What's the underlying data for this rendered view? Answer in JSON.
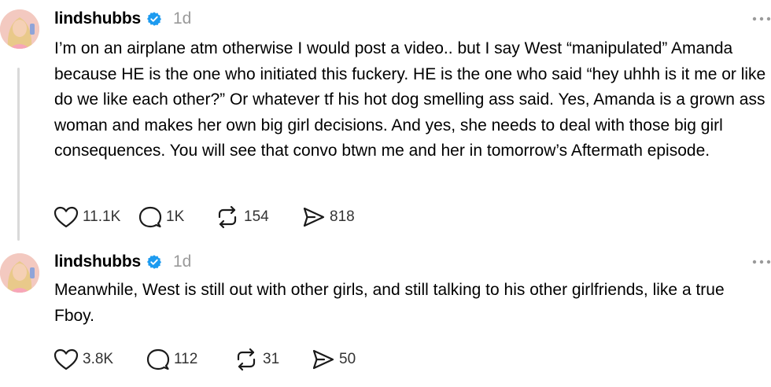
{
  "posts": [
    {
      "username": "lindshubbs",
      "time": "1d",
      "text": "I’m on an airplane atm otherwise I would post a video.. but I say West “manipulated” Amanda because HE is the one who initiated this fuckery. HE is the one who said “hey uhhh is it me or like do we like each other?” Or whatever tf his hot dog smelling ass said. Yes, Amanda is a grown ass woman and makes her own big girl decisions. And yes, she needs to deal with those big girl consequences. You will see that convo btwn me and her in tomorrow’s Aftermath episode.",
      "likes": "11.1K",
      "replies": "1K",
      "reposts": "154",
      "shares": "818"
    },
    {
      "username": "lindshubbs",
      "time": "1d",
      "text": "Meanwhile, West is still out with other girls, and still talking to his other girlfriends, like a true Fboy.",
      "likes": "3.8K",
      "replies": "112",
      "reposts": "31",
      "shares": "50"
    }
  ],
  "icons": {
    "like": "heart-icon",
    "reply": "speech-bubble-icon",
    "repost": "repost-icon",
    "share": "send-icon",
    "more": "more-horizontal-icon",
    "verified": "verified-badge-icon"
  },
  "colors": {
    "verified": "#1d9bf0",
    "secondary_text": "#9a9a9a",
    "thread_line": "#d9d9d9",
    "avatar_bg": "#f3c9c0"
  }
}
